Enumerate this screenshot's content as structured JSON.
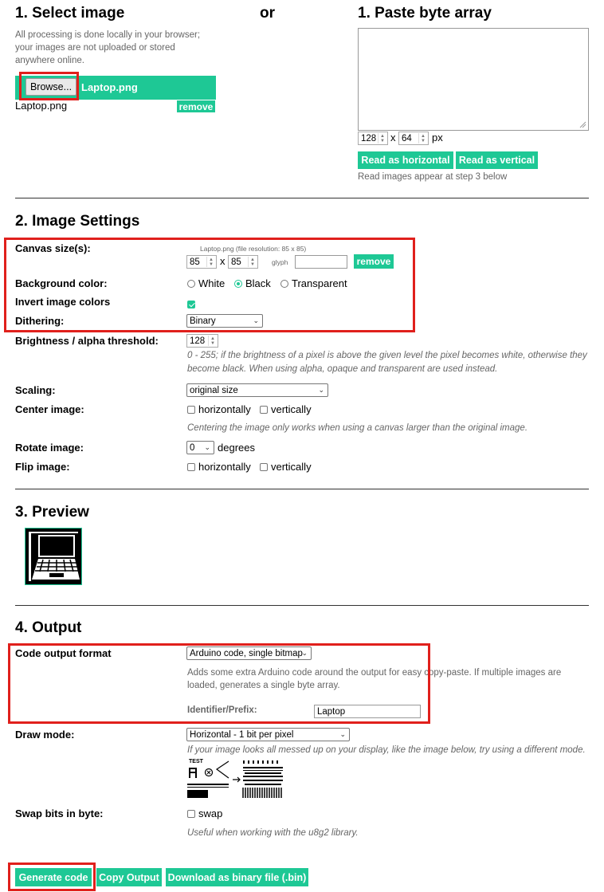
{
  "select_image": {
    "heading": "1. Select image",
    "note": "All processing is done locally in your browser; your images are not uploaded or stored anywhere online.",
    "browse_label": "Browse...",
    "chosen_file": "Laptop.png",
    "file_name": "Laptop.png",
    "remove_label": "remove"
  },
  "or_label": "or",
  "paste": {
    "heading": "1. Paste byte array",
    "width_value": "128",
    "x_label": "x",
    "height_value": "64",
    "px_label": "px",
    "read_horizontal": "Read as horizontal",
    "read_vertical": "Read as vertical",
    "note": "Read images appear at step 3 below"
  },
  "settings": {
    "heading": "2. Image Settings",
    "canvas_label": "Canvas size(s):",
    "canvas_caption": "Laptop.png (file resolution: 85 x 85)",
    "canvas_w": "85",
    "canvas_x": "x",
    "canvas_h": "85",
    "glyph_label": "glyph",
    "remove_label": "remove",
    "bg_label": "Background color:",
    "bg_options": [
      "White",
      "Black",
      "Transparent"
    ],
    "bg_selected": "Black",
    "invert_label": "Invert image colors",
    "invert_checked": true,
    "dither_label": "Dithering:",
    "dither_value": "Binary",
    "threshold_label": "Brightness / alpha threshold:",
    "threshold_value": "128",
    "threshold_note": "0 - 255; if the brightness of a pixel is above the given level the pixel becomes white, otherwise they become black. When using alpha, opaque and transparent are used instead.",
    "scaling_label": "Scaling:",
    "scaling_value": "original size",
    "center_label": "Center image:",
    "horizontally": "horizontally",
    "vertically": "vertically",
    "center_note": "Centering the image only works when using a canvas larger than the original image.",
    "rotate_label": "Rotate image:",
    "rotate_value": "0",
    "degrees": "degrees",
    "flip_label": "Flip image:"
  },
  "preview": {
    "heading": "3. Preview"
  },
  "output": {
    "heading": "4. Output",
    "format_label": "Code output format",
    "format_value": "Arduino code, single bitmap",
    "format_note": "Adds some extra Arduino code around the output for easy copy-paste. If multiple images are loaded, generates a single byte array.",
    "identifier_label": "Identifier/Prefix:",
    "identifier_value": "Laptop",
    "draw_label": "Draw mode:",
    "draw_value": "Horizontal - 1 bit per pixel",
    "draw_note": "If your image looks all messed up on your display, like the image below, try using a different mode.",
    "sample_text": "TEST",
    "swap_label": "Swap bits in byte:",
    "swap_option": "swap",
    "swap_note": "Useful when working with the u8g2 library.",
    "generate": "Generate code",
    "copy": "Copy Output",
    "download": "Download as binary file (.bin)"
  },
  "colors": {
    "accent": "#1ec895",
    "highlight": "#e0201c"
  }
}
